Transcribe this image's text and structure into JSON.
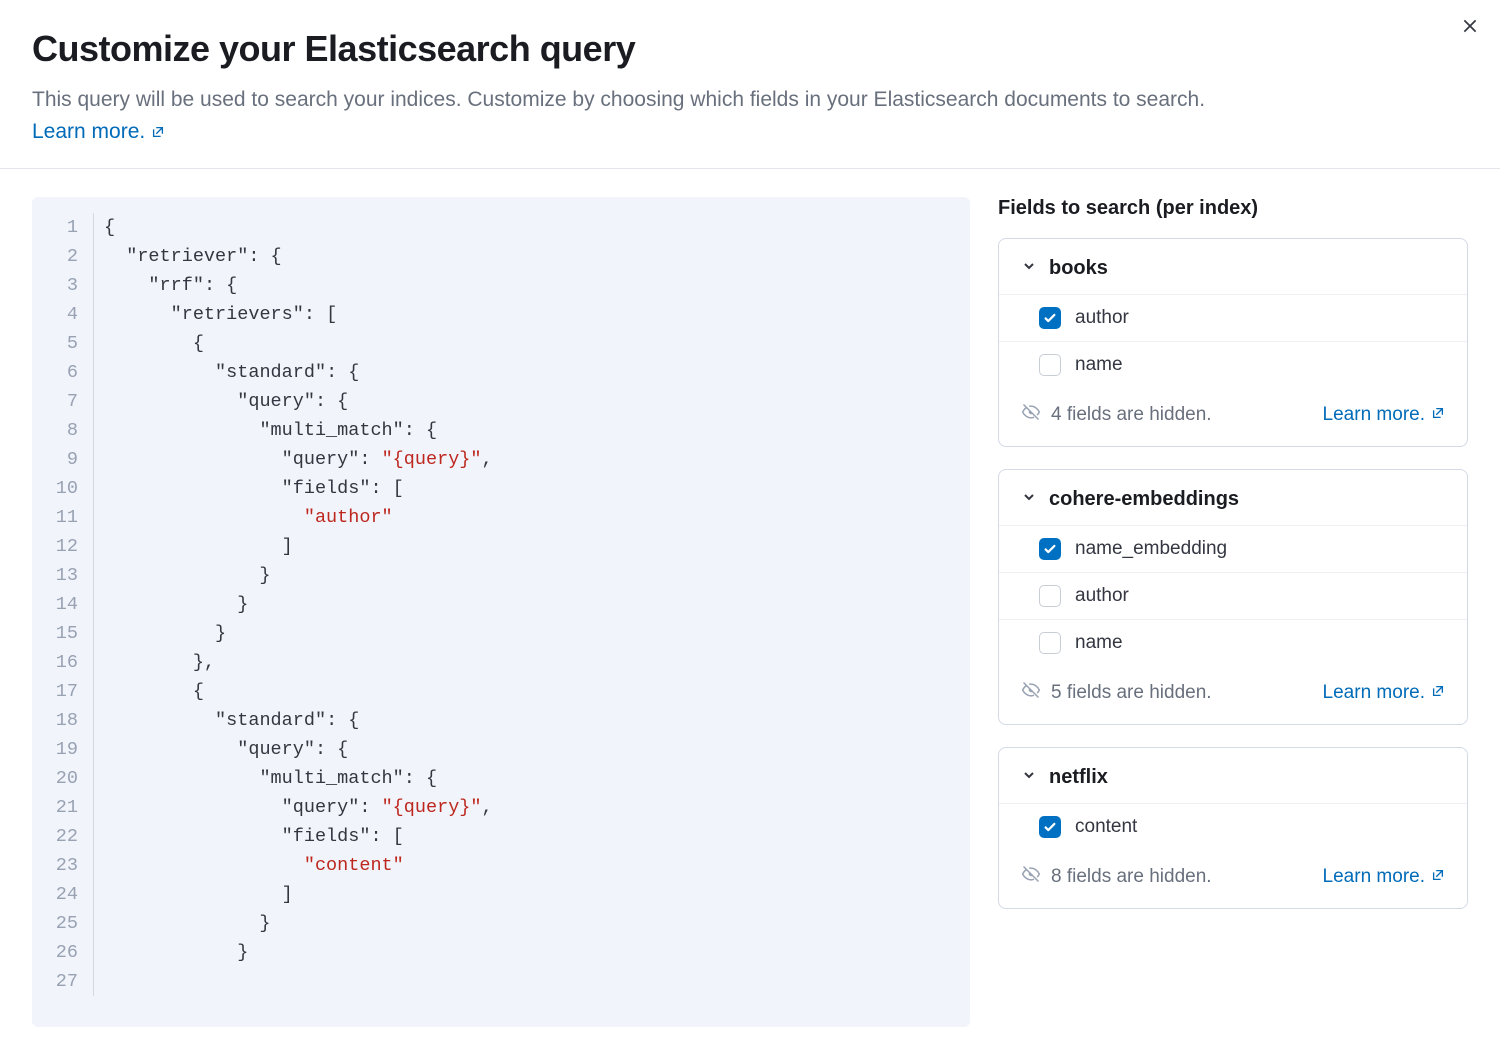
{
  "header": {
    "title": "Customize your Elasticsearch query",
    "subtitle": "This query will be used to search your indices. Customize by choosing which fields in your Elasticsearch documents to search.",
    "learn_more": "Learn more."
  },
  "code": {
    "lines": [
      {
        "n": 1,
        "segs": [
          {
            "t": "{",
            "c": "punc"
          }
        ]
      },
      {
        "n": 2,
        "segs": [
          {
            "t": "  ",
            "c": "punc"
          },
          {
            "t": "\"retriever\"",
            "c": "key"
          },
          {
            "t": ": {",
            "c": "punc"
          }
        ]
      },
      {
        "n": 3,
        "segs": [
          {
            "t": "    ",
            "c": "punc"
          },
          {
            "t": "\"rrf\"",
            "c": "key"
          },
          {
            "t": ": {",
            "c": "punc"
          }
        ]
      },
      {
        "n": 4,
        "segs": [
          {
            "t": "      ",
            "c": "punc"
          },
          {
            "t": "\"retrievers\"",
            "c": "key"
          },
          {
            "t": ": [",
            "c": "punc"
          }
        ]
      },
      {
        "n": 5,
        "segs": [
          {
            "t": "        {",
            "c": "punc"
          }
        ]
      },
      {
        "n": 6,
        "segs": [
          {
            "t": "          ",
            "c": "punc"
          },
          {
            "t": "\"standard\"",
            "c": "key"
          },
          {
            "t": ": {",
            "c": "punc"
          }
        ]
      },
      {
        "n": 7,
        "segs": [
          {
            "t": "            ",
            "c": "punc"
          },
          {
            "t": "\"query\"",
            "c": "key"
          },
          {
            "t": ": {",
            "c": "punc"
          }
        ]
      },
      {
        "n": 8,
        "segs": [
          {
            "t": "              ",
            "c": "punc"
          },
          {
            "t": "\"multi_match\"",
            "c": "key"
          },
          {
            "t": ": {",
            "c": "punc"
          }
        ]
      },
      {
        "n": 9,
        "segs": [
          {
            "t": "                ",
            "c": "punc"
          },
          {
            "t": "\"query\"",
            "c": "key"
          },
          {
            "t": ": ",
            "c": "punc"
          },
          {
            "t": "\"{query}\"",
            "c": "str"
          },
          {
            "t": ",",
            "c": "punc"
          }
        ]
      },
      {
        "n": 10,
        "segs": [
          {
            "t": "                ",
            "c": "punc"
          },
          {
            "t": "\"fields\"",
            "c": "key"
          },
          {
            "t": ": [",
            "c": "punc"
          }
        ]
      },
      {
        "n": 11,
        "segs": [
          {
            "t": "                  ",
            "c": "punc"
          },
          {
            "t": "\"author\"",
            "c": "str"
          }
        ]
      },
      {
        "n": 12,
        "segs": [
          {
            "t": "                ]",
            "c": "punc"
          }
        ]
      },
      {
        "n": 13,
        "segs": [
          {
            "t": "              }",
            "c": "punc"
          }
        ]
      },
      {
        "n": 14,
        "segs": [
          {
            "t": "            }",
            "c": "punc"
          }
        ]
      },
      {
        "n": 15,
        "segs": [
          {
            "t": "          }",
            "c": "punc"
          }
        ]
      },
      {
        "n": 16,
        "segs": [
          {
            "t": "        },",
            "c": "punc"
          }
        ]
      },
      {
        "n": 17,
        "segs": [
          {
            "t": "        {",
            "c": "punc"
          }
        ]
      },
      {
        "n": 18,
        "segs": [
          {
            "t": "          ",
            "c": "punc"
          },
          {
            "t": "\"standard\"",
            "c": "key"
          },
          {
            "t": ": {",
            "c": "punc"
          }
        ]
      },
      {
        "n": 19,
        "segs": [
          {
            "t": "            ",
            "c": "punc"
          },
          {
            "t": "\"query\"",
            "c": "key"
          },
          {
            "t": ": {",
            "c": "punc"
          }
        ]
      },
      {
        "n": 20,
        "segs": [
          {
            "t": "              ",
            "c": "punc"
          },
          {
            "t": "\"multi_match\"",
            "c": "key"
          },
          {
            "t": ": {",
            "c": "punc"
          }
        ]
      },
      {
        "n": 21,
        "segs": [
          {
            "t": "                ",
            "c": "punc"
          },
          {
            "t": "\"query\"",
            "c": "key"
          },
          {
            "t": ": ",
            "c": "punc"
          },
          {
            "t": "\"{query}\"",
            "c": "str"
          },
          {
            "t": ",",
            "c": "punc"
          }
        ]
      },
      {
        "n": 22,
        "segs": [
          {
            "t": "                ",
            "c": "punc"
          },
          {
            "t": "\"fields\"",
            "c": "key"
          },
          {
            "t": ": [",
            "c": "punc"
          }
        ]
      },
      {
        "n": 23,
        "segs": [
          {
            "t": "                  ",
            "c": "punc"
          },
          {
            "t": "\"content\"",
            "c": "str"
          }
        ]
      },
      {
        "n": 24,
        "segs": [
          {
            "t": "                ]",
            "c": "punc"
          }
        ]
      },
      {
        "n": 25,
        "segs": [
          {
            "t": "              }",
            "c": "punc"
          }
        ]
      },
      {
        "n": 26,
        "segs": [
          {
            "t": "            }",
            "c": "punc"
          }
        ]
      },
      {
        "n": 27,
        "segs": [
          {
            "t": "",
            "c": "punc"
          }
        ]
      }
    ]
  },
  "fields_panel": {
    "title": "Fields to search (per index)",
    "learn_more": "Learn more.",
    "indices": [
      {
        "name": "books",
        "fields": [
          {
            "label": "author",
            "checked": true
          },
          {
            "label": "name",
            "checked": false
          }
        ],
        "hidden_text": "4 fields are hidden."
      },
      {
        "name": "cohere-embeddings",
        "fields": [
          {
            "label": "name_embedding",
            "checked": true
          },
          {
            "label": "author",
            "checked": false
          },
          {
            "label": "name",
            "checked": false
          }
        ],
        "hidden_text": "5 fields are hidden."
      },
      {
        "name": "netflix",
        "fields": [
          {
            "label": "content",
            "checked": true
          }
        ],
        "hidden_text": "8 fields are hidden."
      }
    ]
  }
}
